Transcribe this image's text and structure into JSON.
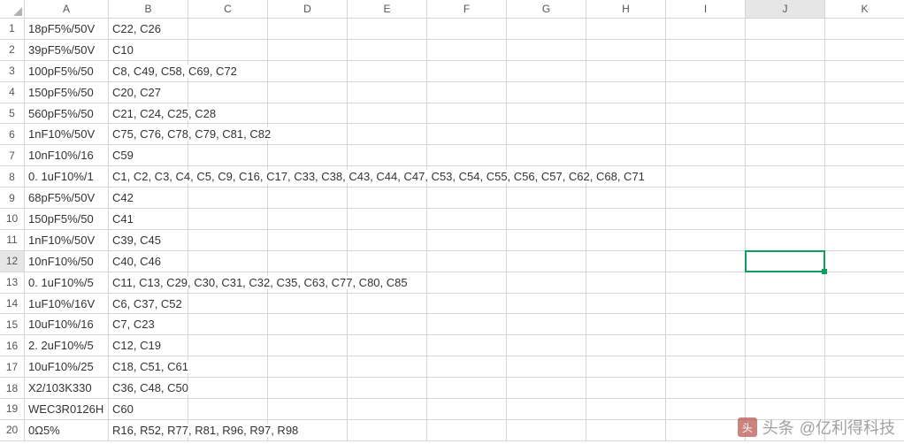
{
  "columns": [
    "A",
    "B",
    "C",
    "D",
    "E",
    "F",
    "G",
    "H",
    "I",
    "J",
    "K"
  ],
  "active_cell": {
    "col": "J",
    "row": 12
  },
  "rows": [
    {
      "n": 1,
      "A": "18pF5%/50V",
      "B": "C22, C26"
    },
    {
      "n": 2,
      "A": "39pF5%/50V",
      "B": "C10"
    },
    {
      "n": 3,
      "A": "100pF5%/50",
      "B": "C8, C49, C58, C69, C72"
    },
    {
      "n": 4,
      "A": "150pF5%/50",
      "B": "C20, C27"
    },
    {
      "n": 5,
      "A": "560pF5%/50",
      "B": "C21, C24, C25, C28"
    },
    {
      "n": 6,
      "A": "1nF10%/50V",
      "B": "C75, C76, C78, C79, C81, C82"
    },
    {
      "n": 7,
      "A": "10nF10%/16",
      "B": "C59"
    },
    {
      "n": 8,
      "A": "0. 1uF10%/1",
      "B": "C1, C2, C3, C4, C5, C9, C16, C17, C33, C38, C43, C44, C47, C53, C54, C55, C56, C57, C62, C68, C71"
    },
    {
      "n": 9,
      "A": "68pF5%/50V",
      "B": "C42"
    },
    {
      "n": 10,
      "A": "150pF5%/50",
      "B": "C41"
    },
    {
      "n": 11,
      "A": "1nF10%/50V",
      "B": "C39, C45"
    },
    {
      "n": 12,
      "A": "10nF10%/50",
      "B": "C40, C46"
    },
    {
      "n": 13,
      "A": "0. 1uF10%/5",
      "B": "C11, C13, C29, C30, C31, C32, C35, C63, C77, C80, C85"
    },
    {
      "n": 14,
      "A": "1uF10%/16V",
      "B": "C6, C37, C52"
    },
    {
      "n": 15,
      "A": "10uF10%/16",
      "B": "C7, C23"
    },
    {
      "n": 16,
      "A": "2. 2uF10%/5",
      "B": "C12, C19"
    },
    {
      "n": 17,
      "A": "10uF10%/25",
      "B": "C18, C51, C61"
    },
    {
      "n": 18,
      "A": "X2/103K330",
      "B": "C36, C48, C50"
    },
    {
      "n": 19,
      "A": "WEC3R0126H",
      "B": "C60"
    },
    {
      "n": 20,
      "A": "0Ω5%",
      "B": "R16, R52, R77, R81, R96, R97, R98"
    }
  ],
  "watermark": {
    "prefix": "头条",
    "text": "@亿利得科技"
  }
}
